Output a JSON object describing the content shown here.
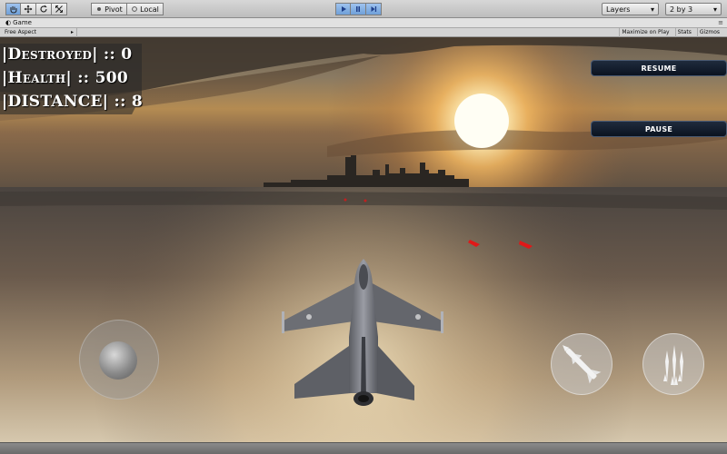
{
  "toolbar": {
    "tools": [
      {
        "name": "hand-tool-icon"
      },
      {
        "name": "move-tool-icon"
      },
      {
        "name": "rotate-tool-icon"
      },
      {
        "name": "scale-tool-icon"
      }
    ],
    "pivot_label": "Pivot",
    "local_label": "Local",
    "play_controls": [
      "play-icon",
      "pause-icon",
      "step-icon"
    ],
    "layers_label": "Layers",
    "layout_label": "2 by 3"
  },
  "game_tab": {
    "title": "Game",
    "aspect": "Free Aspect",
    "maximize_label": "Maximize on Play",
    "stats_label": "Stats",
    "gizmos_label": "Gizmos"
  },
  "hud": {
    "destroyed": "|Destroyed| :: 0",
    "health": "|Health| :: 500",
    "distance": "|DISTANCE| :: 8"
  },
  "buttons": {
    "resume": "RESUME",
    "pause": "PAUSE"
  },
  "controls": {
    "joystick": "joystick",
    "missile_button": "missile-icon",
    "bomb_button": "bombs-icon"
  },
  "colors": {
    "play_active": "#6f9fd8",
    "button_bg": "#0b1320",
    "sun": "#fff6d0"
  }
}
